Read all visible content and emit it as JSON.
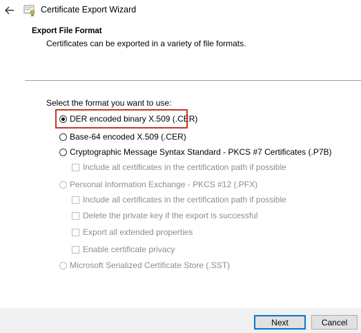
{
  "window": {
    "title": "Certificate Export Wizard"
  },
  "header": {
    "title": "Export File Format",
    "subtitle": "Certificates can be exported in a variety of file formats."
  },
  "form": {
    "prompt": "Select the format you want to use:",
    "options": [
      {
        "label": "DER encoded binary X.509 (.CER)",
        "checked": true,
        "enabled": true
      },
      {
        "label": "Base-64 encoded X.509 (.CER)",
        "checked": false,
        "enabled": true
      },
      {
        "label": "Cryptographic Message Syntax Standard - PKCS #7 Certificates (.P7B)",
        "checked": false,
        "enabled": true
      },
      {
        "label": "Personal Information Exchange - PKCS #12 (.PFX)",
        "checked": false,
        "enabled": false
      },
      {
        "label": "Microsoft Serialized Certificate Store (.SST)",
        "checked": false,
        "enabled": false
      }
    ],
    "p7b_suboptions": [
      {
        "label": "Include all certificates in the certification path if possible",
        "checked": false,
        "enabled": false
      }
    ],
    "pfx_suboptions": [
      {
        "label": "Include all certificates in the certification path if possible",
        "checked": false,
        "enabled": false
      },
      {
        "label": "Delete the private key if the export is successful",
        "checked": false,
        "enabled": false
      },
      {
        "label": "Export all extended properties",
        "checked": false,
        "enabled": false
      },
      {
        "label": "Enable certificate privacy",
        "checked": false,
        "enabled": false
      }
    ]
  },
  "buttons": {
    "next": "Next",
    "cancel": "Cancel"
  },
  "colors": {
    "highlight": "#c0392b",
    "primary_border": "#0078d7"
  }
}
